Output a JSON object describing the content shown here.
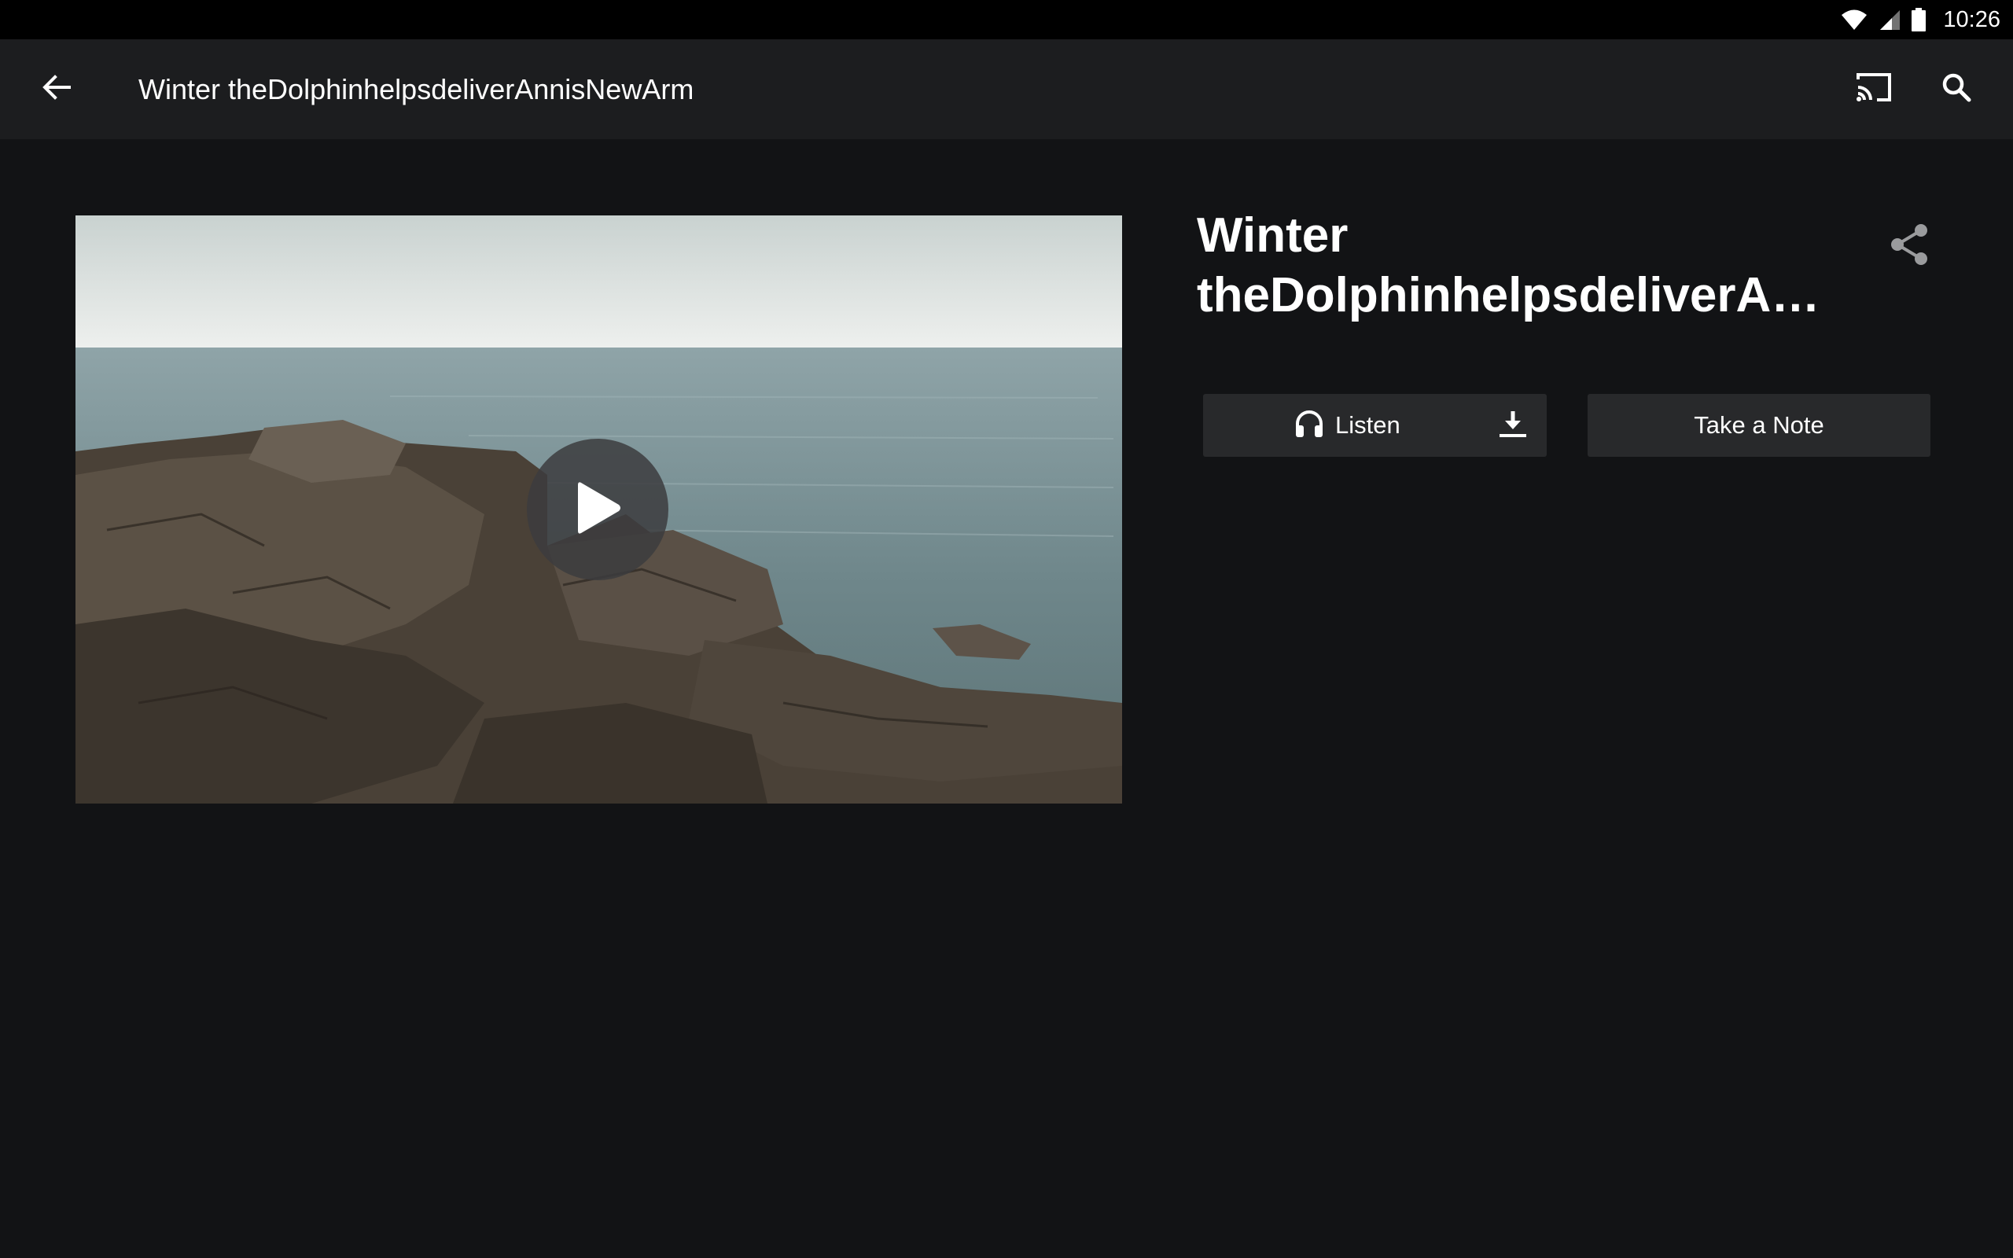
{
  "status_bar": {
    "time": "10:26",
    "icons": [
      "wifi-icon",
      "cellular-signal-icon",
      "battery-icon"
    ]
  },
  "app_bar": {
    "title": "Winter theDolphinhelpsdeliverAnnisNewArm",
    "icons": [
      "back-arrow-icon",
      "cast-icon",
      "search-icon"
    ]
  },
  "video": {
    "thumbnail": "rocky-shoreline-sea-image",
    "play_icon": "play-icon"
  },
  "episode": {
    "title_line1": "Winter",
    "title_line2": "theDolphinhelpsdeliverAn…",
    "share_icon": "share-icon"
  },
  "actions": {
    "listen_label": "Listen",
    "listen_icon": "headphones-icon",
    "download_icon": "download-icon",
    "note_label": "Take a Note"
  },
  "colors": {
    "background": "#121315",
    "app_bar": "#1c1d1f",
    "status_bar": "#000000",
    "button_bg": "#28292b",
    "text": "#ffffff"
  }
}
